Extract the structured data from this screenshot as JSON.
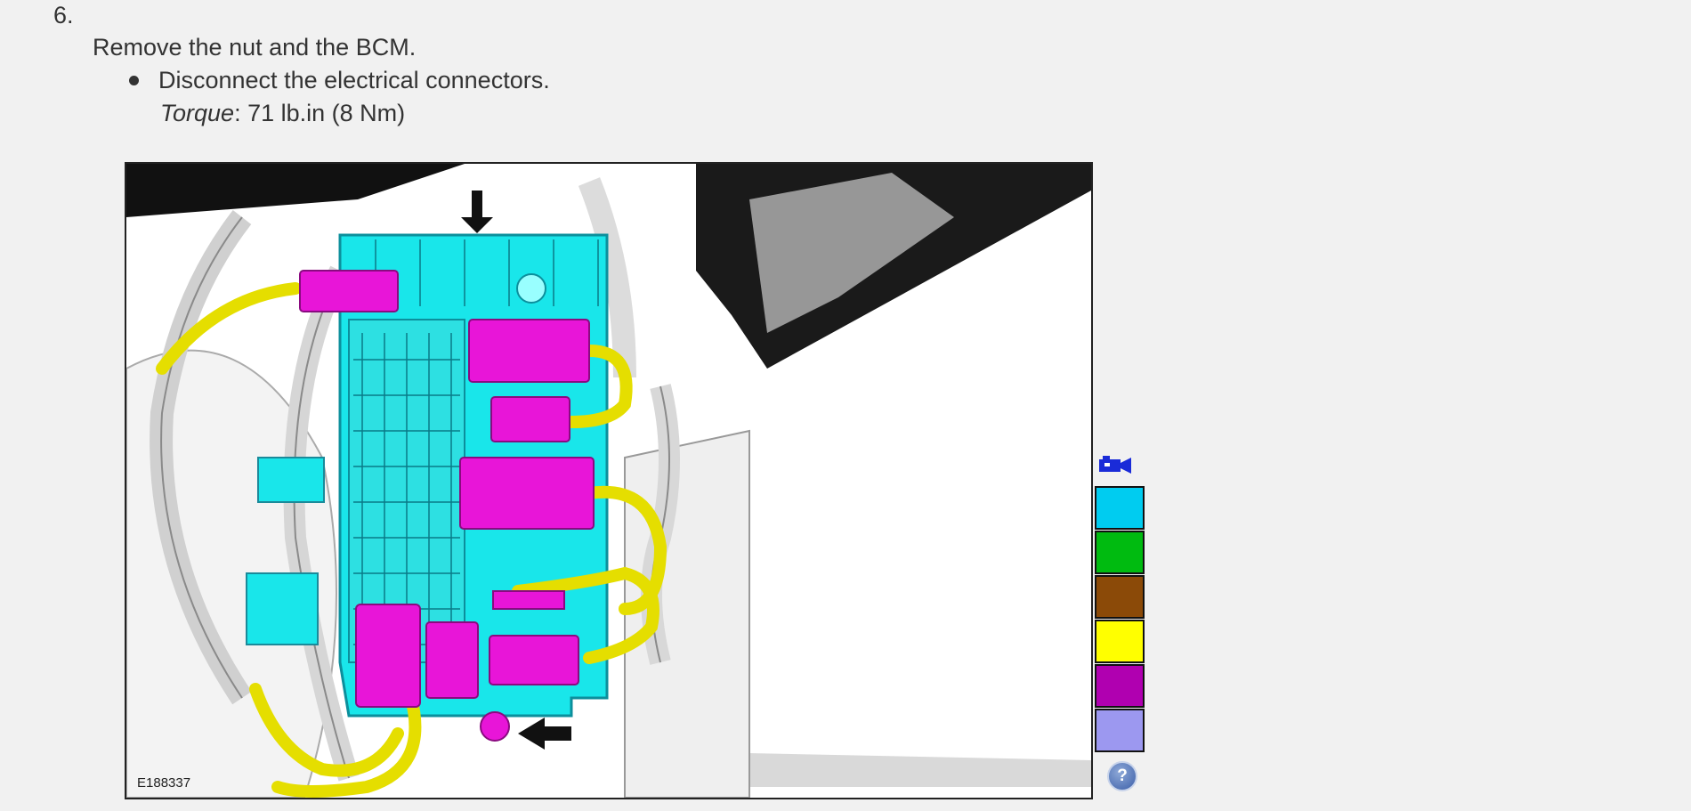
{
  "step": {
    "number": "6.",
    "instruction": "Remove the nut and the BCM.",
    "bullets": [
      "Disconnect the electrical connectors."
    ],
    "torque": {
      "label": "Torque",
      "value": ": 71 lb.in (8 Nm)"
    }
  },
  "figure": {
    "id_label": "E188337"
  },
  "toolbar": {
    "camera_icon": "camera-icon",
    "help_icon": "help-icon",
    "help_glyph": "?",
    "swatches": [
      {
        "name": "cyan",
        "color": "#00ccf0"
      },
      {
        "name": "green",
        "color": "#00bb10"
      },
      {
        "name": "brown",
        "color": "#8b4a08"
      },
      {
        "name": "yellow",
        "color": "#ffff00"
      },
      {
        "name": "magenta",
        "color": "#b000b0"
      },
      {
        "name": "lavender",
        "color": "#9c98f0"
      }
    ]
  },
  "colors": {
    "module": "#19e6ea",
    "connector": "#e815d8",
    "harness": "#e5de00"
  }
}
